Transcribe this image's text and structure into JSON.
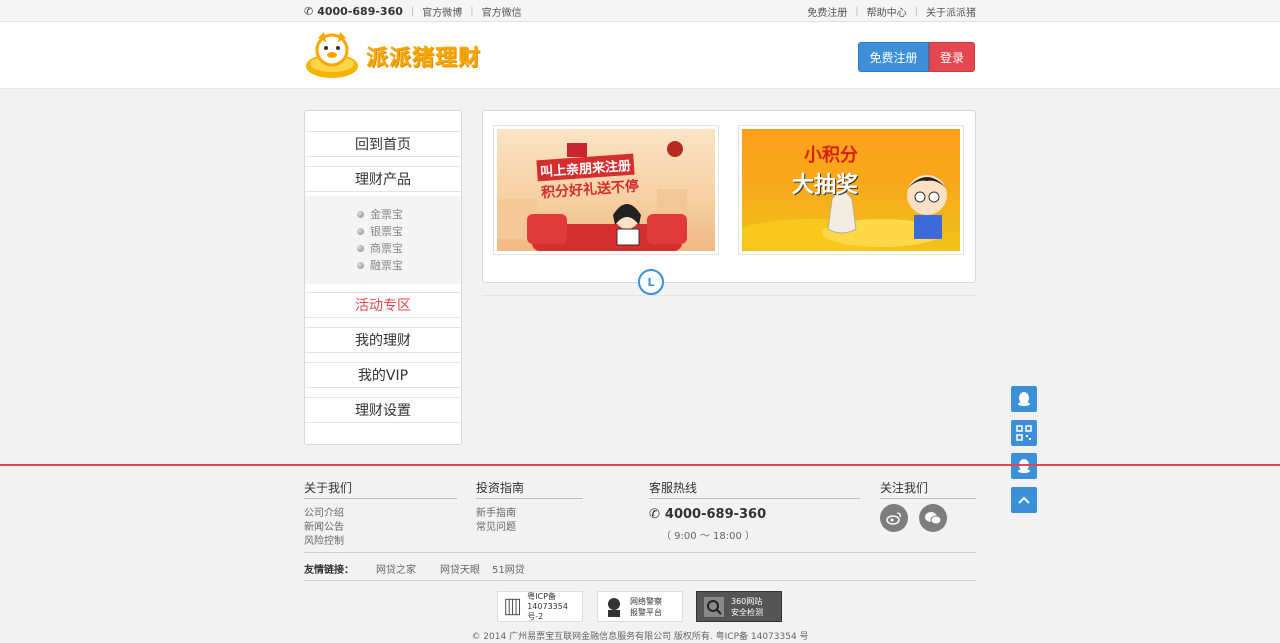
{
  "topbar": {
    "phone": "4000-689-360",
    "links_left": [
      "官方微博",
      "官方微信"
    ],
    "links_right": [
      "免费注册",
      "帮助中心",
      "关于派派猪"
    ]
  },
  "header": {
    "logo_text": "派派猪理财",
    "register_label": "免费注册",
    "login_label": "登录"
  },
  "sidebar": {
    "items": [
      {
        "label": "回到首页"
      },
      {
        "label": "理财产品"
      },
      {
        "label": "活动专区"
      },
      {
        "label": "我的理财"
      },
      {
        "label": "我的VIP"
      },
      {
        "label": "理财设置"
      }
    ],
    "sub_items": [
      "金票宝",
      "银票宝",
      "商票宝",
      "融票宝"
    ],
    "active": "活动专区"
  },
  "promos": [
    {
      "line1": "叫上亲朋来注册",
      "line2": "积分好礼送不停"
    },
    {
      "line1": "小积分",
      "line2": "大抽奖"
    }
  ],
  "timeline": {
    "marker": "L"
  },
  "floating": {
    "icons": [
      "qq-icon",
      "qr-code-icon",
      "qq-chat-icon",
      "back-to-top-icon"
    ]
  },
  "footer": {
    "about": {
      "title": "关于我们",
      "links": [
        "公司介绍",
        "新闻公告",
        "风险控制"
      ]
    },
    "guide": {
      "title": "投资指南",
      "links": [
        "新手指南",
        "常见问题"
      ]
    },
    "hotline": {
      "title": "客服热线",
      "phone": "4000-689-360",
      "hours": "（ 9:00 ～ 18:00 ）"
    },
    "follow": {
      "title": "关注我们"
    },
    "friend_links_label": "友情链接：",
    "friend_links": [
      "网贷之家",
      "网贷天眼",
      "51网贷"
    ],
    "badges": [
      {
        "line1": "粤ICP备",
        "line2": "14073354号-2"
      },
      {
        "line1": "网络警察",
        "line2": "报警平台"
      },
      {
        "line1": "360网站",
        "line2": "安全检测"
      }
    ],
    "copyright": "© 2014 广州易票宝互联网金融信息服务有限公司 版权所有. 粤ICP备 14073354 号"
  },
  "colors": {
    "accent_blue": "#3c8fd8",
    "accent_red": "#e4474f",
    "logo_orange": "#f6a800"
  }
}
